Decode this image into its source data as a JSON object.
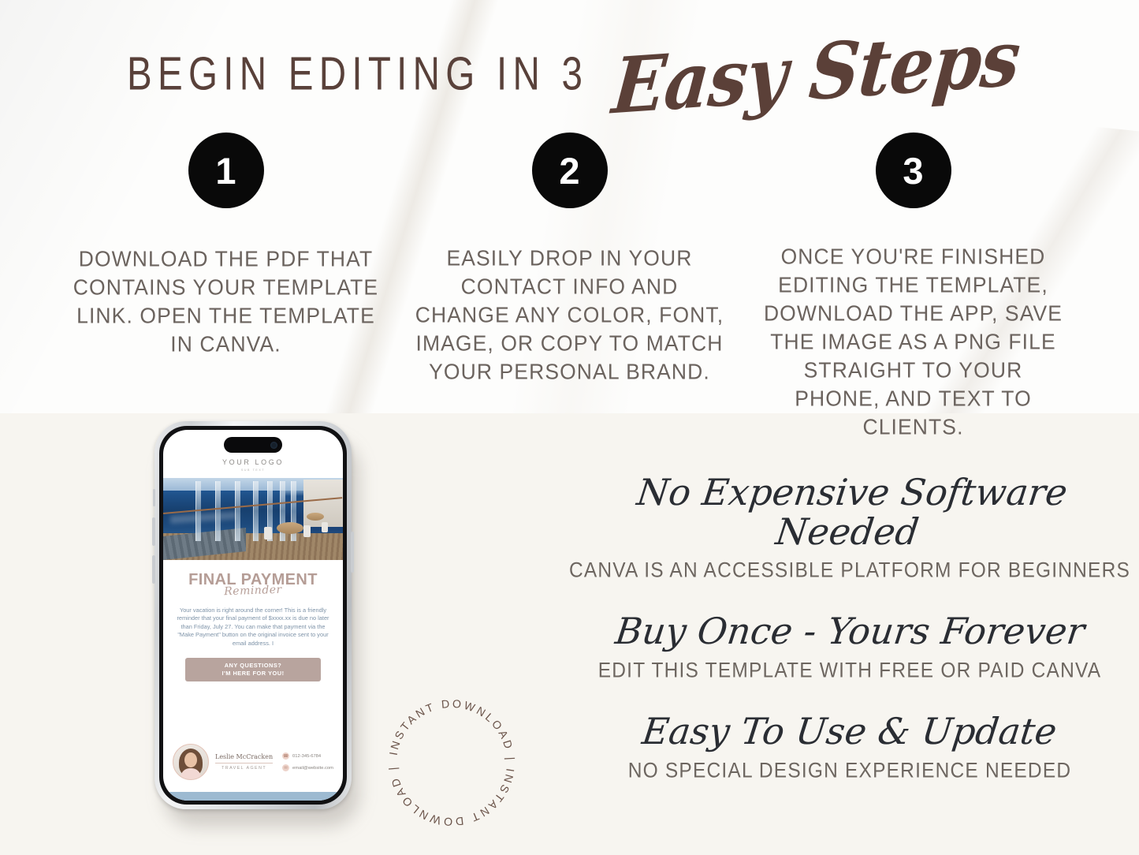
{
  "heading": {
    "main": "BEGIN EDITING IN 3",
    "script": "Easy Steps"
  },
  "steps": [
    {
      "number": "1",
      "text": "DOWNLOAD THE PDF THAT CONTAINS YOUR TEMPLATE LINK. OPEN THE TEMPLATE IN CANVA."
    },
    {
      "number": "2",
      "text": "EASILY DROP IN YOUR CONTACT INFO AND CHANGE ANY COLOR, FONT, IMAGE, OR COPY TO MATCH YOUR PERSONAL BRAND."
    },
    {
      "number": "3",
      "text": "ONCE YOU'RE FINISHED EDITING THE TEMPLATE, DOWNLOAD THE APP, SAVE THE IMAGE AS A PNG FILE STRAIGHT TO YOUR PHONE, AND TEXT TO CLIENTS."
    }
  ],
  "phone": {
    "logo": "YOUR LOGO",
    "logo_sub": "SUB TEXT",
    "title_main": "FINAL PAYMENT",
    "title_script": "Reminder",
    "body": "Your vacation is right around the corner! This is a friendly reminder that your final payment of $xxxx.xx is due no later than Friday, July 27. You can make that payment via the \"Make Payment\" button on the original invoice sent to your email address. I",
    "cta_line1": "ANY QUESTIONS?",
    "cta_line2": "I'M HERE FOR YOU!",
    "agent_name": "Leslie McCracken",
    "agent_role": "TRAVEL AGENT",
    "phone_number": "012-345-6784",
    "email": "email@website.com",
    "phone_icon": "phone-icon",
    "email_icon": "envelope-icon",
    "accent_color": "#b8a49e",
    "text_color": "#7e93a8"
  },
  "badge": {
    "text": "INSTANT DOWNLOAD | INSTANT DOWNLOAD | "
  },
  "benefits": [
    {
      "script": "No Expensive Software Needed",
      "sub": "CANVA IS AN ACCESSIBLE PLATFORM FOR BEGINNERS"
    },
    {
      "script": "Buy Once - Yours Forever",
      "sub": "EDIT THIS TEMPLATE WITH FREE OR PAID CANVA"
    },
    {
      "script": "Easy To Use & Update",
      "sub": "NO SPECIAL DESIGN EXPERIENCE NEEDED"
    }
  ],
  "colors": {
    "heading": "#59413a",
    "step_text": "#6b635e",
    "top_bg": "#fdfdfc",
    "bottom_bg": "#f7f5f0",
    "circle_bg": "#090909",
    "script_dark": "#2a2d33"
  }
}
